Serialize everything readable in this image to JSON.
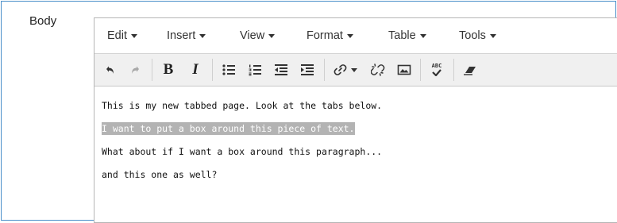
{
  "field": {
    "label": "Body"
  },
  "menubar": {
    "items": [
      "Edit",
      "Insert",
      "View",
      "Format",
      "Table",
      "Tools"
    ]
  },
  "toolbar": {
    "icons": [
      "undo-icon",
      "redo-icon",
      "bold-icon",
      "italic-icon",
      "bullet-list-icon",
      "numbered-list-icon",
      "outdent-icon",
      "indent-icon",
      "link-icon",
      "unlink-icon",
      "image-icon",
      "spellcheck-icon",
      "eraser-icon"
    ],
    "bold_glyph": "B",
    "italic_glyph": "I",
    "spell_glyph": "ABC"
  },
  "content": {
    "paragraphs": [
      "This is my new tabbed page. Look at the tabs below.",
      "I want to put a box around this piece of text.",
      "What about if I want a box around this paragraph...",
      "and this one as well?"
    ]
  }
}
